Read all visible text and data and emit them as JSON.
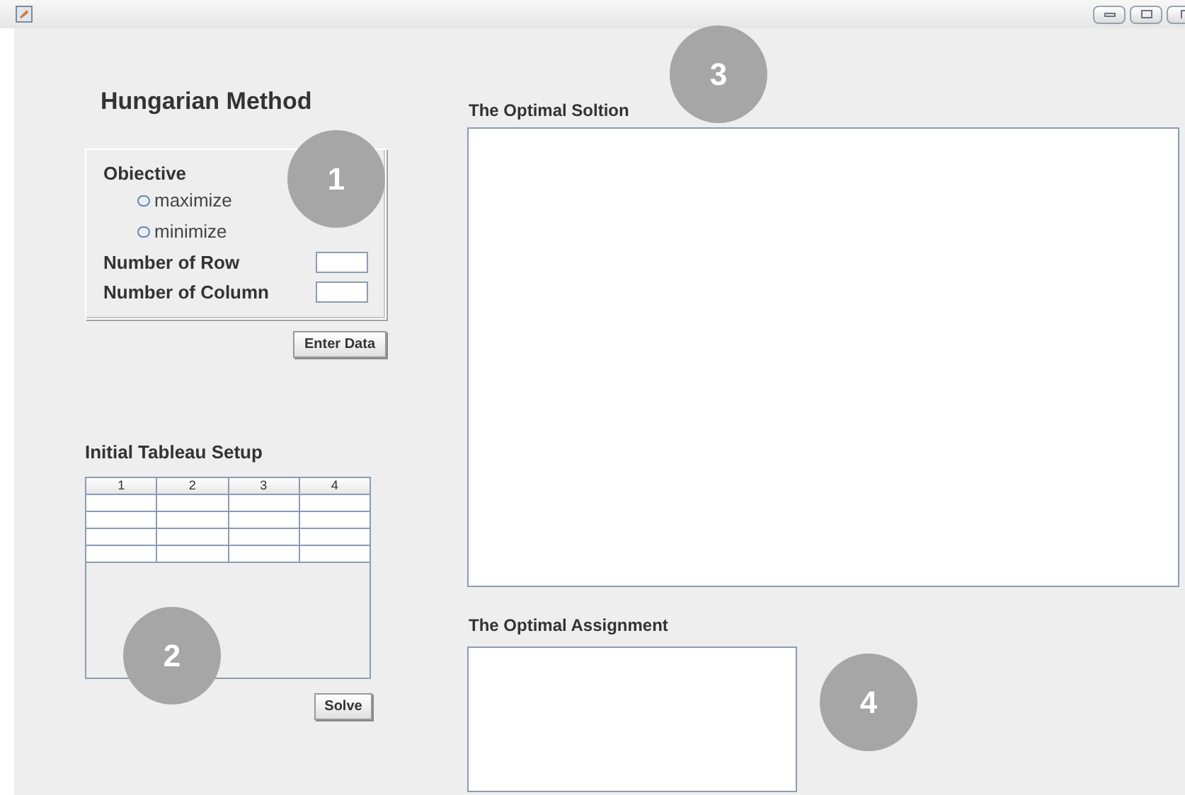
{
  "window": {
    "controls": [
      {
        "kind": "minimize"
      },
      {
        "kind": "maximize"
      },
      {
        "kind": "close"
      }
    ]
  },
  "title": "Hungarian Method",
  "objective": {
    "label": "Obiective",
    "options": [
      {
        "label": "maximize",
        "selected": false
      },
      {
        "label": "minimize",
        "selected": false
      }
    ],
    "fields": [
      {
        "label": "Number of Row"
      },
      {
        "label": "Number of Column"
      }
    ]
  },
  "enter_button": "Enter Data",
  "tableau": {
    "label": "Initial Tableau Setup",
    "columns": [
      "1",
      "2",
      "3",
      "4"
    ]
  },
  "solve_button": "Solve",
  "solution": {
    "label": "The Optimal Soltion"
  },
  "assignment": {
    "label": "The Optimal Assignment"
  },
  "annotations": [
    "1",
    "2",
    "3",
    "4"
  ]
}
